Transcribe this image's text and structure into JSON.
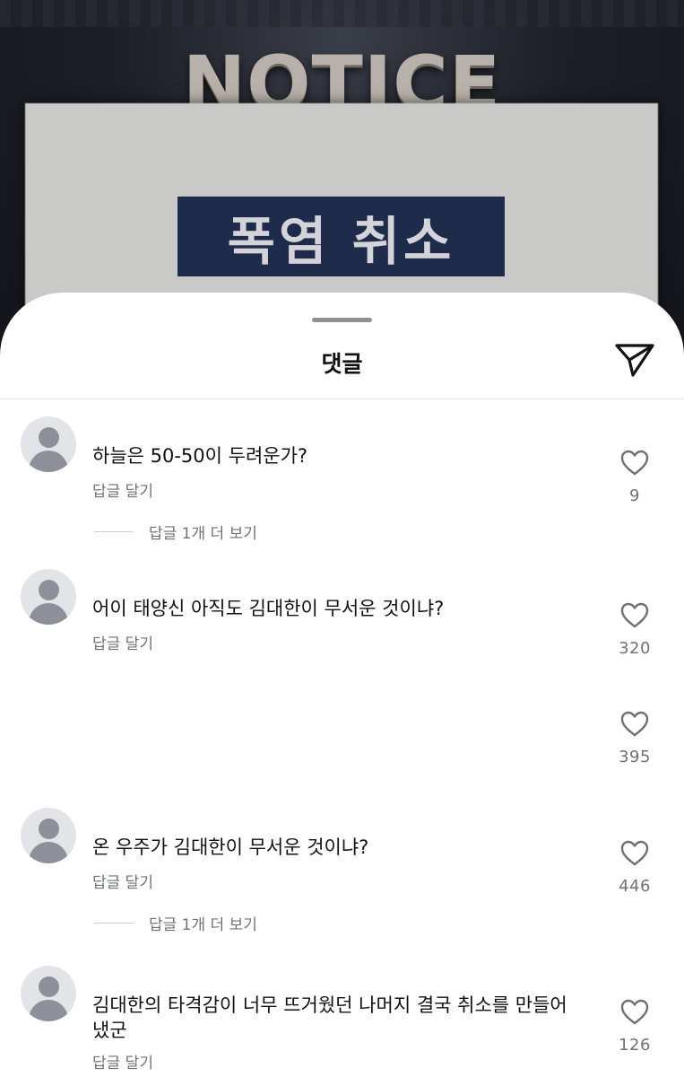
{
  "background_post": {
    "title": "NOTICE",
    "banner_text": "폭염 취소"
  },
  "sheet": {
    "title": "댓글",
    "send_icon": "send-icon"
  },
  "comments": [
    {
      "text": "하늘은 50-50이 두려운가?",
      "reply_label": "답글 달기",
      "more_replies": "답글 1개 더 보기",
      "likes": "9"
    },
    {
      "text": "어이 태양신 아직도 김대한이 무서운 것이냐?",
      "reply_label": "답글 달기",
      "likes": "320"
    },
    {
      "likes": "395"
    },
    {
      "text": "온 우주가 김대한이 무서운 것이냐?",
      "reply_label": "답글 달기",
      "more_replies": "답글 1개 더 보기",
      "likes": "446"
    },
    {
      "text": "김대한의 타격감이 너무 뜨거웠던 나머지 결국 취소를 만들어냈군",
      "reply_label": "답글 달기",
      "likes": "126"
    }
  ],
  "colors": {
    "sheet_bg": "#ffffff",
    "secondary_text": "#6f7178",
    "avatar_bg": "#e3e4e8",
    "avatar_fg": "#8d9099"
  }
}
